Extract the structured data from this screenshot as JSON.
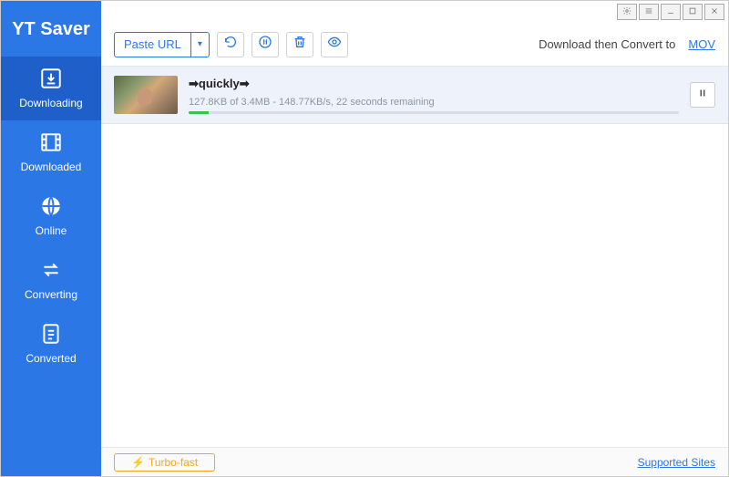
{
  "app": {
    "title": "YT Saver"
  },
  "sidebar": {
    "items": [
      {
        "label": "Downloading"
      },
      {
        "label": "Downloaded"
      },
      {
        "label": "Online"
      },
      {
        "label": "Converting"
      },
      {
        "label": "Converted"
      }
    ]
  },
  "toolbar": {
    "paste_label": "Paste URL",
    "convert_label": "Download then Convert to",
    "convert_format": "MOV"
  },
  "downloads": [
    {
      "title": "➡quickly➡",
      "status": "127.8KB of 3.4MB - 148.77KB/s, 22 seconds remaining",
      "progress_pct": 4
    }
  ],
  "footer": {
    "turbo_label": "Turbo-fast",
    "supported_label": "Supported Sites"
  }
}
